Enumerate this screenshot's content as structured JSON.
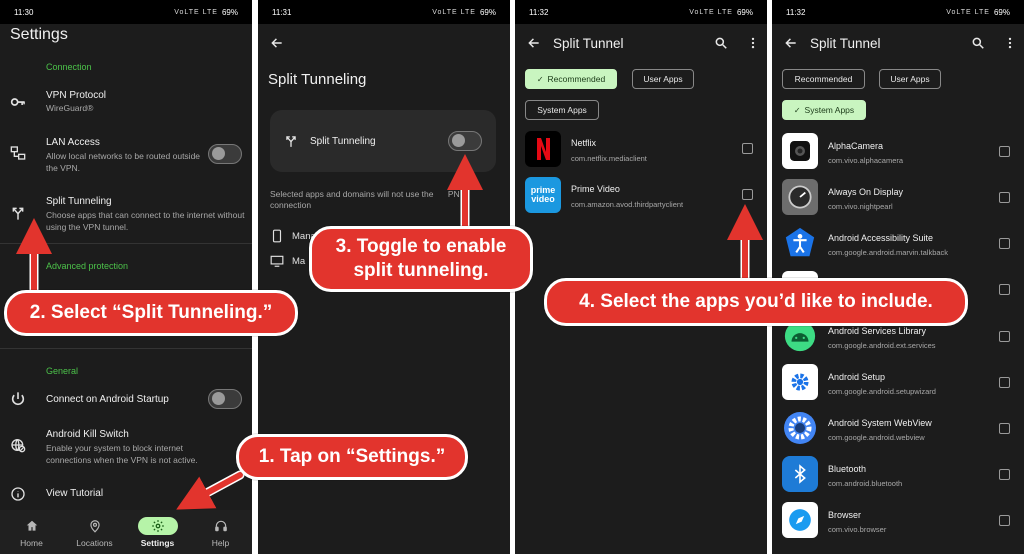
{
  "status": {
    "p1_time": "11:30",
    "p2_time": "11:31",
    "p3_time": "11:32",
    "p4_time": "11:32",
    "signal": "VoLTE LTE",
    "battery": "69%"
  },
  "settings": {
    "title": "Settings",
    "connection_header": "Connection",
    "vpn_protocol_title": "VPN Protocol",
    "vpn_protocol_sub": "WireGuard®",
    "lan_title": "LAN Access",
    "lan_sub": "Allow local networks to be routed outside the VPN.",
    "split_title": "Split Tunneling",
    "split_sub": "Choose apps that can connect to the internet without using the VPN tunnel.",
    "advanced_header": "Advanced protection",
    "general_header": "General",
    "startup_title": "Connect on Android Startup",
    "kill_title": "Android Kill Switch",
    "kill_sub": "Enable your system to block internet connections when the VPN is not active.",
    "tutorial_title": "View Tutorial"
  },
  "nav": {
    "home": "Home",
    "locations": "Locations",
    "settings": "Settings",
    "help": "Help",
    "active_color": "#b6f4a8"
  },
  "split_page": {
    "title": "Split Tunneling",
    "toggle_label": "Split Tunneling",
    "desc_a": "Selected apps and domains will not use the ",
    "desc_b": "PN connection",
    "row1": "Mana",
    "row2": "Ma"
  },
  "split_tunnel": {
    "title": "Split Tunnel",
    "chip_recommended": "Recommended",
    "chip_user": "User Apps",
    "chip_system": "System Apps",
    "recommended_apps": [
      {
        "name": "Netflix",
        "pkg": "com.netflix.mediaclient"
      },
      {
        "name": "Prime Video",
        "pkg": "com.amazon.avod.thirdpartyclient"
      }
    ],
    "system_apps": [
      {
        "name": "AlphaCamera",
        "pkg": "com.vivo.alphacamera"
      },
      {
        "name": "Always On Display",
        "pkg": "com.vivo.nightpearl"
      },
      {
        "name": "Android Accessibility Suite",
        "pkg": "com.google.android.marvin.talkback"
      },
      {
        "name": "Android Services Library",
        "pkg": "com.google.android.ext.services"
      },
      {
        "name": "Android Setup",
        "pkg": "com.google.android.setupwizard"
      },
      {
        "name": "Android System WebView",
        "pkg": "com.google.android.webview"
      },
      {
        "name": "Bluetooth",
        "pkg": "com.android.bluetooth"
      },
      {
        "name": "Browser",
        "pkg": "com.vivo.browser"
      }
    ],
    "prime_logo_top": "prime",
    "prime_logo_bottom": "video"
  },
  "callouts": {
    "step1": "1. Tap on “Settings.”",
    "step2": "2. Select “Split Tunneling.”",
    "step3_line1": "3. Toggle to enable",
    "step3_line2": "split tunneling.",
    "step4": "4. Select the apps you’d like to include.",
    "color": "#e2342d"
  }
}
